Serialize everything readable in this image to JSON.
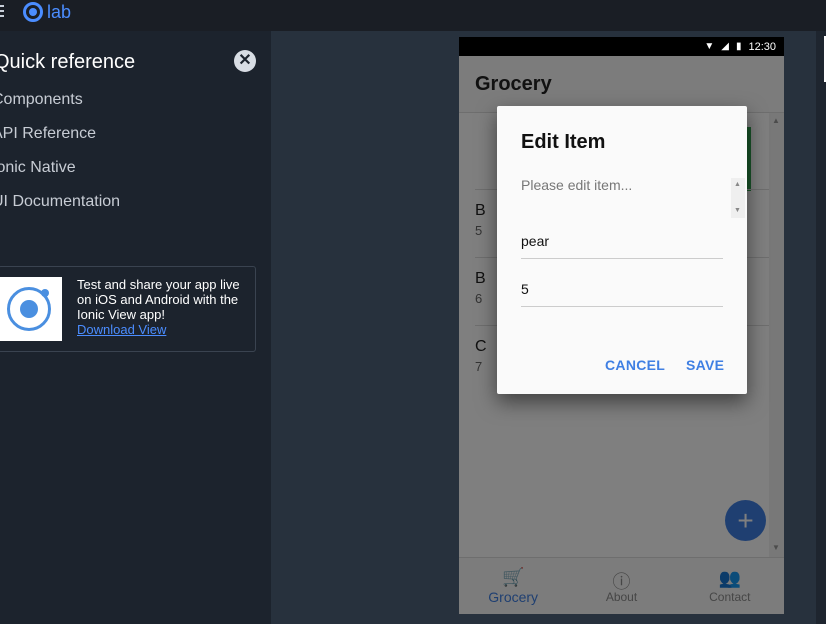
{
  "lab": {
    "logo_text": "lab"
  },
  "sidebar": {
    "title": "Quick reference",
    "links": [
      "Components",
      "API Reference",
      "Ionic Native",
      "UI Documentation"
    ],
    "promo": {
      "text": "Test and share your app live on iOS and Android with the Ionic View app!",
      "link": "Download View"
    }
  },
  "device": {
    "status": {
      "time": "12:30"
    },
    "header": {
      "title": "Grocery"
    },
    "list": [
      {
        "name": "B",
        "qty": "5"
      },
      {
        "name": "B",
        "qty": "6"
      },
      {
        "name": "C",
        "qty": "7"
      }
    ],
    "tabs": [
      {
        "label": "Grocery",
        "icon": "cart-icon"
      },
      {
        "label": "About",
        "icon": "info-icon"
      },
      {
        "label": "Contact",
        "icon": "contacts-icon"
      }
    ]
  },
  "dialog": {
    "title": "Edit Item",
    "message": "Please edit item...",
    "inputs": [
      {
        "value": "pear"
      },
      {
        "value": "5"
      }
    ],
    "cancel": "CANCEL",
    "save": "SAVE"
  },
  "colors": {
    "accent": "#3f7fe3",
    "lab_blue": "#4b8dff",
    "sidebar_bg": "#1c232d",
    "green": "#32a852"
  }
}
